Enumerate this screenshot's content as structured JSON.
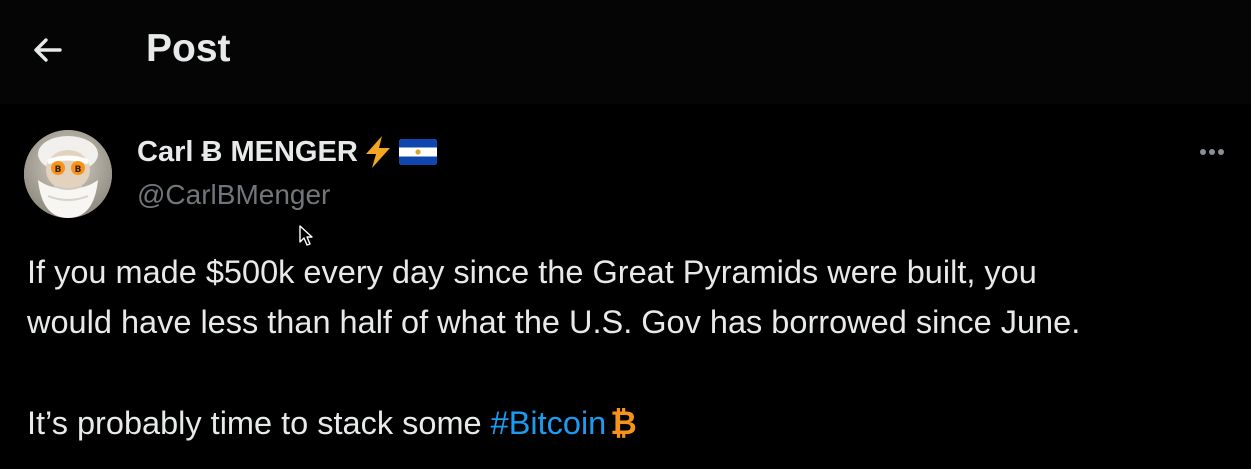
{
  "header": {
    "back_icon": "arrow-left-icon",
    "title": "Post"
  },
  "post": {
    "author": {
      "display_name": "Carl Ƀ MENGER",
      "handle": "@CarlBMenger",
      "badges": [
        "lightning-bolt-icon",
        "el-salvador-flag-icon"
      ],
      "avatar": "avatar-bearded-man-bitcoin-eyes"
    },
    "more_icon": "more-options-icon",
    "text": {
      "line1": "If you made $500k every day since the Great Pyramids were built, you",
      "line2": "would have less than half of what the U.S. Gov has borrowed since June.",
      "line3_prefix": "It’s probably time to stack some ",
      "hashtag": "#Bitcoin",
      "btc_emoji": "₿"
    }
  },
  "colors": {
    "background": "#000000",
    "text": "#e7e9ea",
    "secondary": "#71767b",
    "link": "#1d9bf0",
    "bitcoin_orange": "#f7931a",
    "bolt": "#f5a623"
  }
}
